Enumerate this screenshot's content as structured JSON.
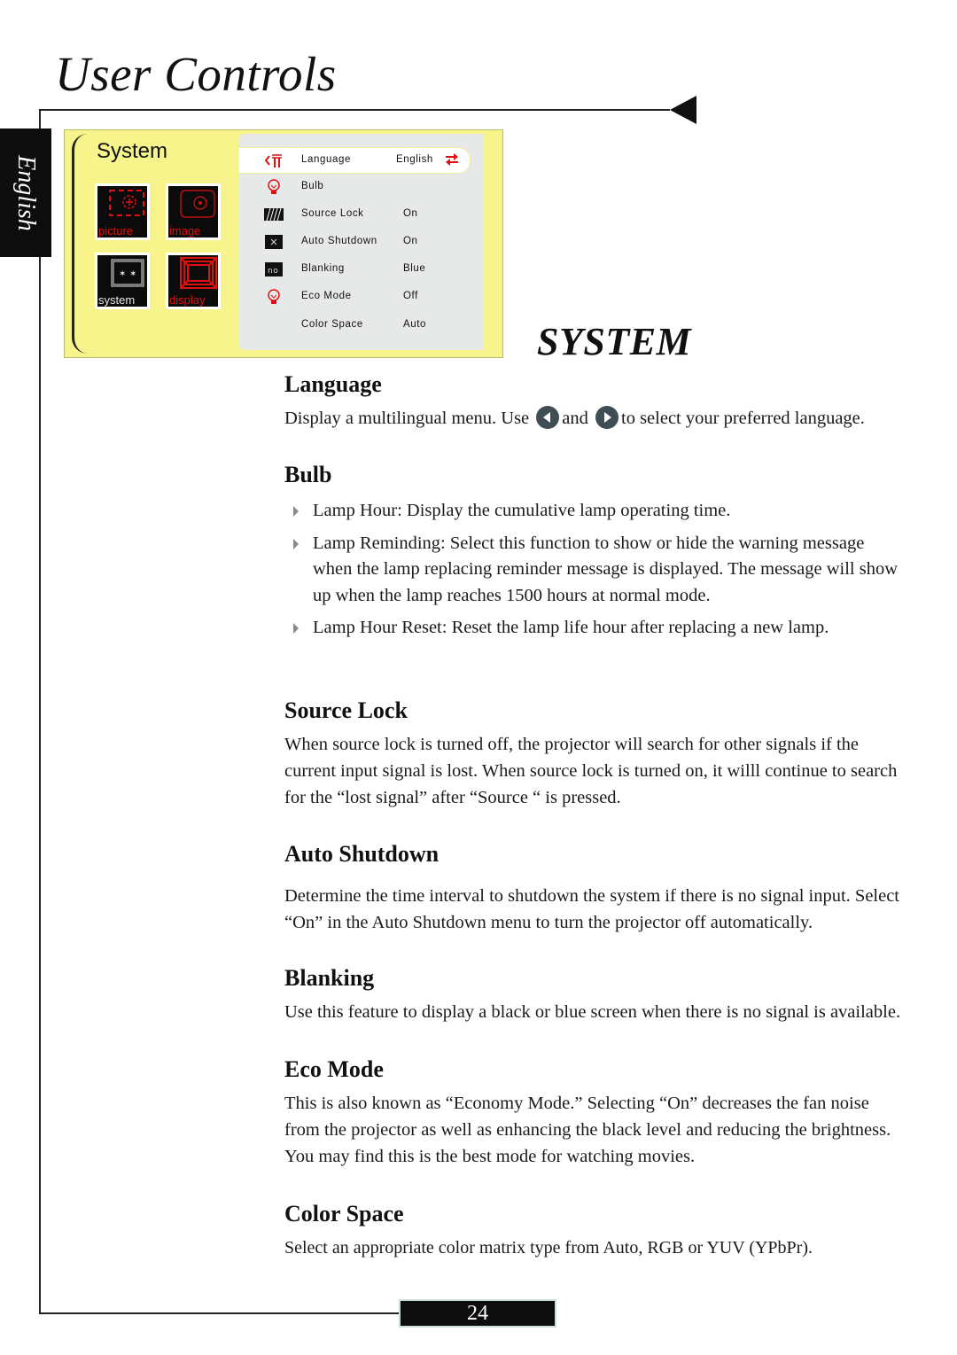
{
  "header": {
    "title": "User Controls",
    "language_tab": "English",
    "section_title": "SYSTEM"
  },
  "osd_menu": {
    "title": "System",
    "tiles": [
      {
        "label": "picture",
        "icon": "picture-icon"
      },
      {
        "label": "image",
        "icon": "image-icon"
      },
      {
        "label": "system",
        "icon": "system-icon"
      },
      {
        "label": "display",
        "icon": "display-icon"
      }
    ],
    "items": [
      {
        "label": "Language",
        "value": "English",
        "icon": "language-icon",
        "selected": true
      },
      {
        "label": "Bulb",
        "value": "",
        "icon": "bulb-icon"
      },
      {
        "label": "Source Lock",
        "value": "On",
        "icon": "source-lock-icon"
      },
      {
        "label": "Auto Shutdown",
        "value": "On",
        "icon": "auto-shutdown-icon"
      },
      {
        "label": "Blanking",
        "value": "Blue",
        "icon": "blanking-icon"
      },
      {
        "label": "Eco Mode",
        "value": "Off",
        "icon": "eco-mode-icon"
      },
      {
        "label": "Color Space",
        "value": "Auto",
        "icon": ""
      }
    ],
    "colors": {
      "background": "#f6f48a",
      "panel": "#e7e9e9",
      "accent": "#e01010"
    }
  },
  "sections": {
    "language": {
      "heading": "Language",
      "text_a": "Display a multilingual menu. Use",
      "text_b": "and",
      "text_c": "to select your preferred language."
    },
    "bulb": {
      "heading": "Bulb",
      "bullets": [
        "Lamp Hour: Display the cumulative lamp operating time.",
        "Lamp Reminding: Select this function to show or hide the warning message when the lamp replacing reminder message is displayed. The message will show up when the lamp reaches 1500 hours at normal mode.",
        "Lamp Hour Reset: Reset the lamp life hour after replacing a new lamp."
      ]
    },
    "source_lock": {
      "heading": "Source Lock",
      "text": "When source lock is turned off, the projector will search for other signals if the current input signal is lost. When source lock is turned on, it willl continue to search for the “lost signal” after “Source “ is pressed."
    },
    "auto_shutdown": {
      "heading": "Auto Shutdown",
      "text": "Determine the time interval to shutdown the system if there is no signal input. Select “On” in the Auto Shutdown menu to turn the projector off automatically."
    },
    "blanking": {
      "heading": "Blanking",
      "text": "Use this feature to display a black or blue screen when there is no signal is available."
    },
    "eco_mode": {
      "heading": "Eco Mode",
      "text": "This is also known as “Economy Mode.” Selecting “On” decreases the fan noise from the projector as well as enhancing the black level and reducing the brightness. You may find this is the best mode for watching movies."
    },
    "color_space": {
      "heading": "Color Space",
      "text": "Select an appropriate color matrix type from Auto, RGB or YUV (YPbPr)."
    }
  },
  "footer": {
    "page_number": "24"
  }
}
